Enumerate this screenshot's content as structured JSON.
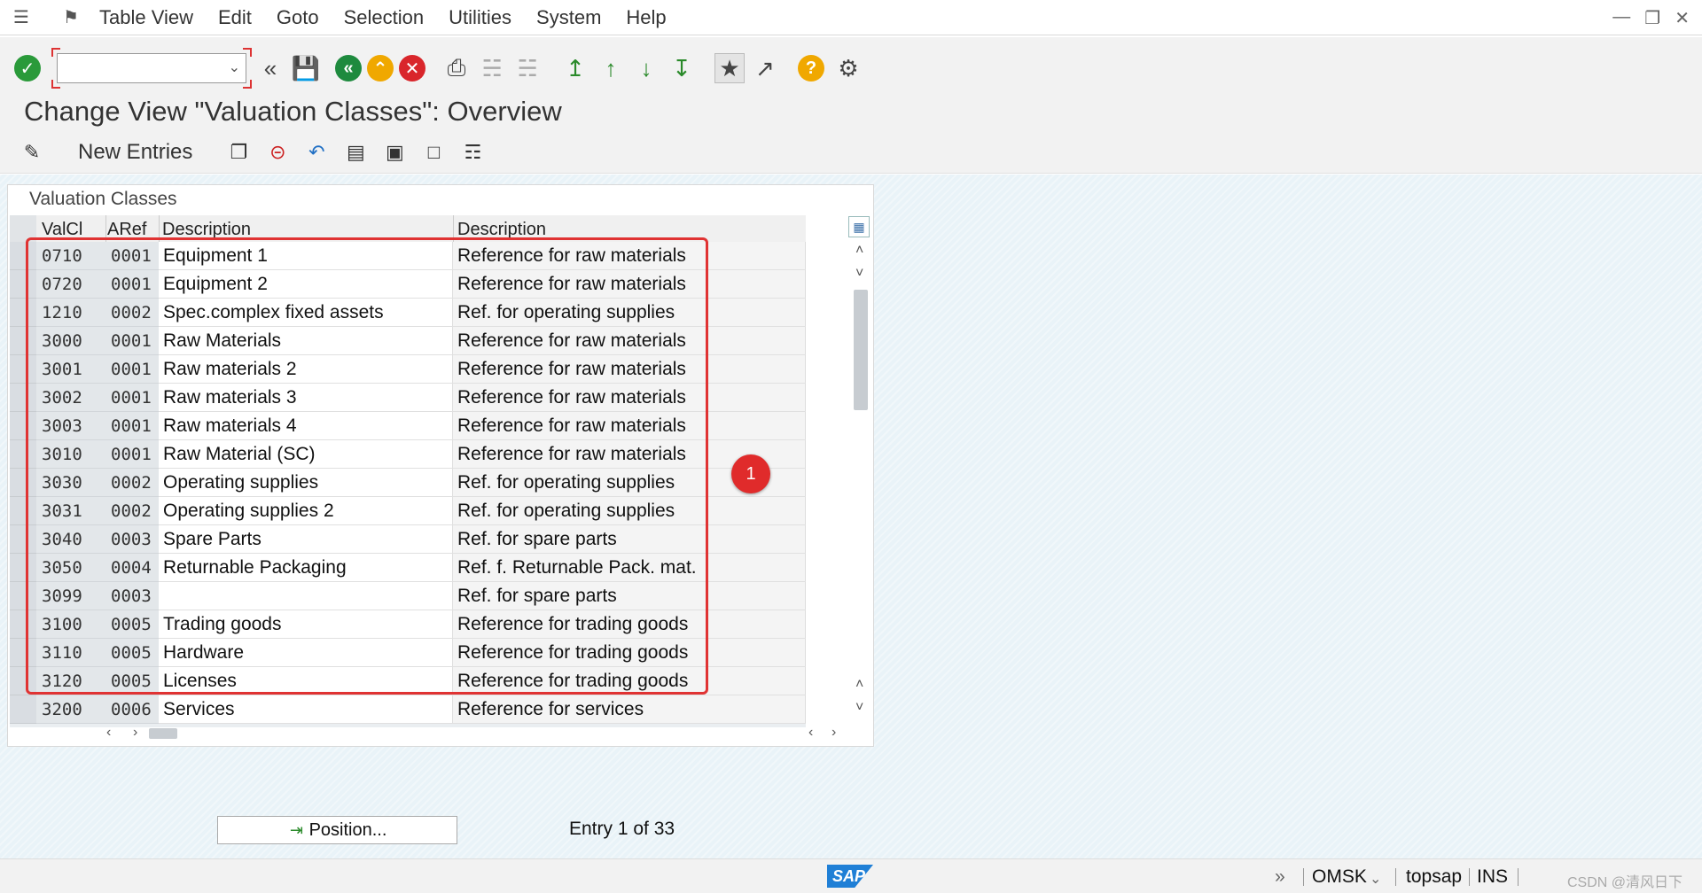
{
  "menu": {
    "items": [
      "Table View",
      "Edit",
      "Goto",
      "Selection",
      "Utilities",
      "System",
      "Help"
    ]
  },
  "toolbar": {
    "command_value": "",
    "icons": [
      "enter-check",
      "command-dropdown",
      "back-double",
      "save",
      "back",
      "exit",
      "cancel",
      "print",
      "find",
      "find-next",
      "first-page",
      "previous-page",
      "next-page",
      "last-page",
      "create-session",
      "create-shortcut",
      "help",
      "customize-layout"
    ]
  },
  "title": "Change View \"Valuation Classes\": Overview",
  "app_toolbar": {
    "new_entries_label": "New Entries"
  },
  "table": {
    "panel_title": "Valuation Classes",
    "columns": [
      "ValCl",
      "ARef",
      "Description",
      "Description"
    ],
    "rows": [
      {
        "valcl": "0710",
        "aref": "0001",
        "desc": "Equipment 1",
        "ref_desc": "Reference for raw materials"
      },
      {
        "valcl": "0720",
        "aref": "0001",
        "desc": "Equipment 2",
        "ref_desc": "Reference for raw materials"
      },
      {
        "valcl": "1210",
        "aref": "0002",
        "desc": "Spec.complex fixed assets",
        "ref_desc": "Ref. for operating supplies"
      },
      {
        "valcl": "3000",
        "aref": "0001",
        "desc": "Raw Materials",
        "ref_desc": "Reference for raw materials"
      },
      {
        "valcl": "3001",
        "aref": "0001",
        "desc": "Raw materials 2",
        "ref_desc": "Reference for raw materials"
      },
      {
        "valcl": "3002",
        "aref": "0001",
        "desc": "Raw materials 3",
        "ref_desc": "Reference for raw materials"
      },
      {
        "valcl": "3003",
        "aref": "0001",
        "desc": "Raw materials 4",
        "ref_desc": "Reference for raw materials"
      },
      {
        "valcl": "3010",
        "aref": "0001",
        "desc": "Raw Material (SC)",
        "ref_desc": "Reference for raw materials"
      },
      {
        "valcl": "3030",
        "aref": "0002",
        "desc": "Operating supplies",
        "ref_desc": "Ref. for operating supplies"
      },
      {
        "valcl": "3031",
        "aref": "0002",
        "desc": "Operating supplies 2",
        "ref_desc": "Ref. for operating supplies"
      },
      {
        "valcl": "3040",
        "aref": "0003",
        "desc": "Spare Parts",
        "ref_desc": "Ref. for spare parts"
      },
      {
        "valcl": "3050",
        "aref": "0004",
        "desc": "Returnable Packaging",
        "ref_desc": "Ref. f. Returnable Pack. mat."
      },
      {
        "valcl": "3099",
        "aref": "0003",
        "desc": "",
        "ref_desc": "Ref. for spare parts"
      },
      {
        "valcl": "3100",
        "aref": "0005",
        "desc": "Trading goods",
        "ref_desc": "Reference for trading goods"
      },
      {
        "valcl": "3110",
        "aref": "0005",
        "desc": "Hardware",
        "ref_desc": "Reference for trading goods"
      },
      {
        "valcl": "3120",
        "aref": "0005",
        "desc": "Licenses",
        "ref_desc": "Reference for trading goods"
      },
      {
        "valcl": "3200",
        "aref": "0006",
        "desc": "Services",
        "ref_desc": "Reference for services"
      }
    ]
  },
  "annotation": {
    "badge": "1",
    "color": "#e03333"
  },
  "footer": {
    "position_label": "Position...",
    "entry_text": "Entry 1 of 33"
  },
  "status": {
    "logo": "SAP",
    "system": "OMSK",
    "host": "topsap",
    "mode": "INS",
    "watermark": "CSDN @清风日下"
  }
}
